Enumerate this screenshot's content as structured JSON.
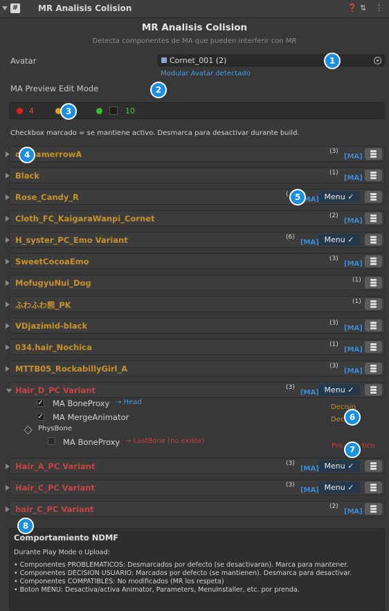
{
  "header": {
    "title": "MR Analisis Colision",
    "icon": "script-icon"
  },
  "main": {
    "title": "MR Analisis Colision",
    "subtitle": "Detecta componentes de MA que pueden interferir con MR"
  },
  "avatar": {
    "label": "Avatar",
    "value": "Cornet_001 (2)",
    "detected": "Modular Avatar detectado"
  },
  "preview_mode": {
    "label": "MA Preview Edit Mode"
  },
  "status": {
    "red_count": "4",
    "orange_count": "",
    "green_count": "10"
  },
  "note": "Checkbox marcado = se mantiene activo. Desmarca para desactivar durante build.",
  "items": [
    {
      "name": "oCreamerrowA",
      "color": "orange",
      "count": "(3)",
      "ma": "[MA]",
      "menu": null
    },
    {
      "name": "Black",
      "color": "orange",
      "count": "(1)",
      "ma": "[MA]",
      "menu": null
    },
    {
      "name": "Rose_Candy_R",
      "color": "orange",
      "count": "(",
      "ma": "[MA]",
      "menu": "Menu ✓"
    },
    {
      "name": "Cloth_FC_KaigaraWanpi_Cornet",
      "color": "orange",
      "count": "(2)",
      "ma": "[MA]",
      "menu": null
    },
    {
      "name": "H_syster_PC_Emo Variant",
      "color": "orange",
      "count": "(6)",
      "ma": "[MA]",
      "menu": "Menu ✓"
    },
    {
      "name": "SweetCocoaEmo",
      "color": "orange",
      "count": "(3)",
      "ma": "[MA]",
      "menu": null
    },
    {
      "name": "MofugyuNui_Dog",
      "color": "orange",
      "count": "(1)",
      "ma": "",
      "menu": null
    },
    {
      "name": "ふわふわ熊_PK",
      "color": "orange",
      "count": "(1)",
      "ma": "",
      "menu": null
    },
    {
      "name": "VDjazimid-black",
      "color": "orange",
      "count": "(3)",
      "ma": "[MA]",
      "menu": null
    },
    {
      "name": "034.hair_Nochica",
      "color": "orange",
      "count": "(1)",
      "ma": "[MA]",
      "menu": null
    },
    {
      "name": "MTTB05_RockabillyGirl_A",
      "color": "orange",
      "count": "(3)",
      "ma": "[MA]",
      "menu": null
    },
    {
      "name": "Hair_D_PC Variant",
      "color": "red",
      "count": "(3)",
      "ma": "[MA]",
      "menu": "Menu ✓",
      "open": true
    },
    {
      "name": "Hair_A_PC Variant",
      "color": "red",
      "count": "(3)",
      "ma": "[MA]",
      "menu": "Menu ✓"
    },
    {
      "name": "Hair_C_PC Variant",
      "color": "red",
      "count": "(3)",
      "ma": "[MA]",
      "menu": "Menu ✓"
    },
    {
      "name": "hair_C_PC Variant",
      "color": "red",
      "count": "(2)",
      "ma": "[MA]",
      "menu": null
    }
  ],
  "expanded": {
    "bone_proxy": {
      "label": "MA BoneProxy",
      "link": "→ Head",
      "tag": "Decisio"
    },
    "merge_animator": {
      "label": "MA MergeAnimator",
      "tag": "Dec"
    },
    "physbone": {
      "label": "PhysBone"
    },
    "bone_proxy_2": {
      "label": "MA BoneProxy",
      "link": "→ LastBone (no existe)",
      "tag": "Pro",
      "tag2": "tico"
    }
  },
  "ndmf": {
    "title": "Comportamiento NDMF",
    "intro": "Durante Play Mode o Upload:",
    "lines": [
      "• Componentes PROBLEMATICOS: Desmarcados por defecto (se desactivaran). Marca para mantener.",
      "• Componentes DECISION USUARIO: Marcados por defecto (se mantienen). Desmarca para desactivar.",
      "• Componentes COMPATIBLES: No modificados (MR los respeta)",
      "• Boton MENU: Desactiva/activa Animator, Parameters, MenuInstaller, etc. por prenda."
    ]
  },
  "badges": [
    "1",
    "2",
    "3",
    "4",
    "5",
    "6",
    "7",
    "8"
  ],
  "colors": {
    "orange": "#c7922c",
    "red": "#c84343",
    "link_blue": "#4a9ed8",
    "badge": "#1a8ee0"
  }
}
